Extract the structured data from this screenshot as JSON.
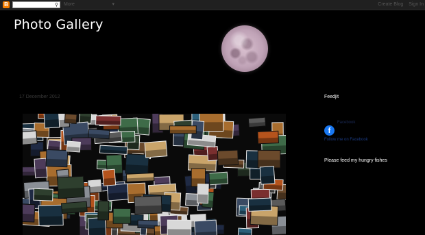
{
  "navbar": {
    "logo_letter": "B",
    "search_placeholder": "",
    "more_label": "More",
    "create_blog": "Create Blog",
    "sign_in": "Sign In",
    "search_icon": "magnifier-icon",
    "chevron_icon": "chevron-down-icon"
  },
  "header": {
    "title": "Photo Gallery",
    "image": "full-moon"
  },
  "post": {
    "date": "17 December 2012",
    "image": "photo-collage"
  },
  "sidebar": {
    "feedjit_heading": "Feedjit",
    "facebook_label": "Facebook",
    "facebook_link": "Follow me on Facebook",
    "fishes_heading": "Please feed my hungry fishes"
  },
  "colors": {
    "background": "#000000",
    "navbar": "#202020",
    "blogger_orange": "#f57d00",
    "facebook_blue": "#1877f2",
    "title_text": "#ffffff"
  }
}
